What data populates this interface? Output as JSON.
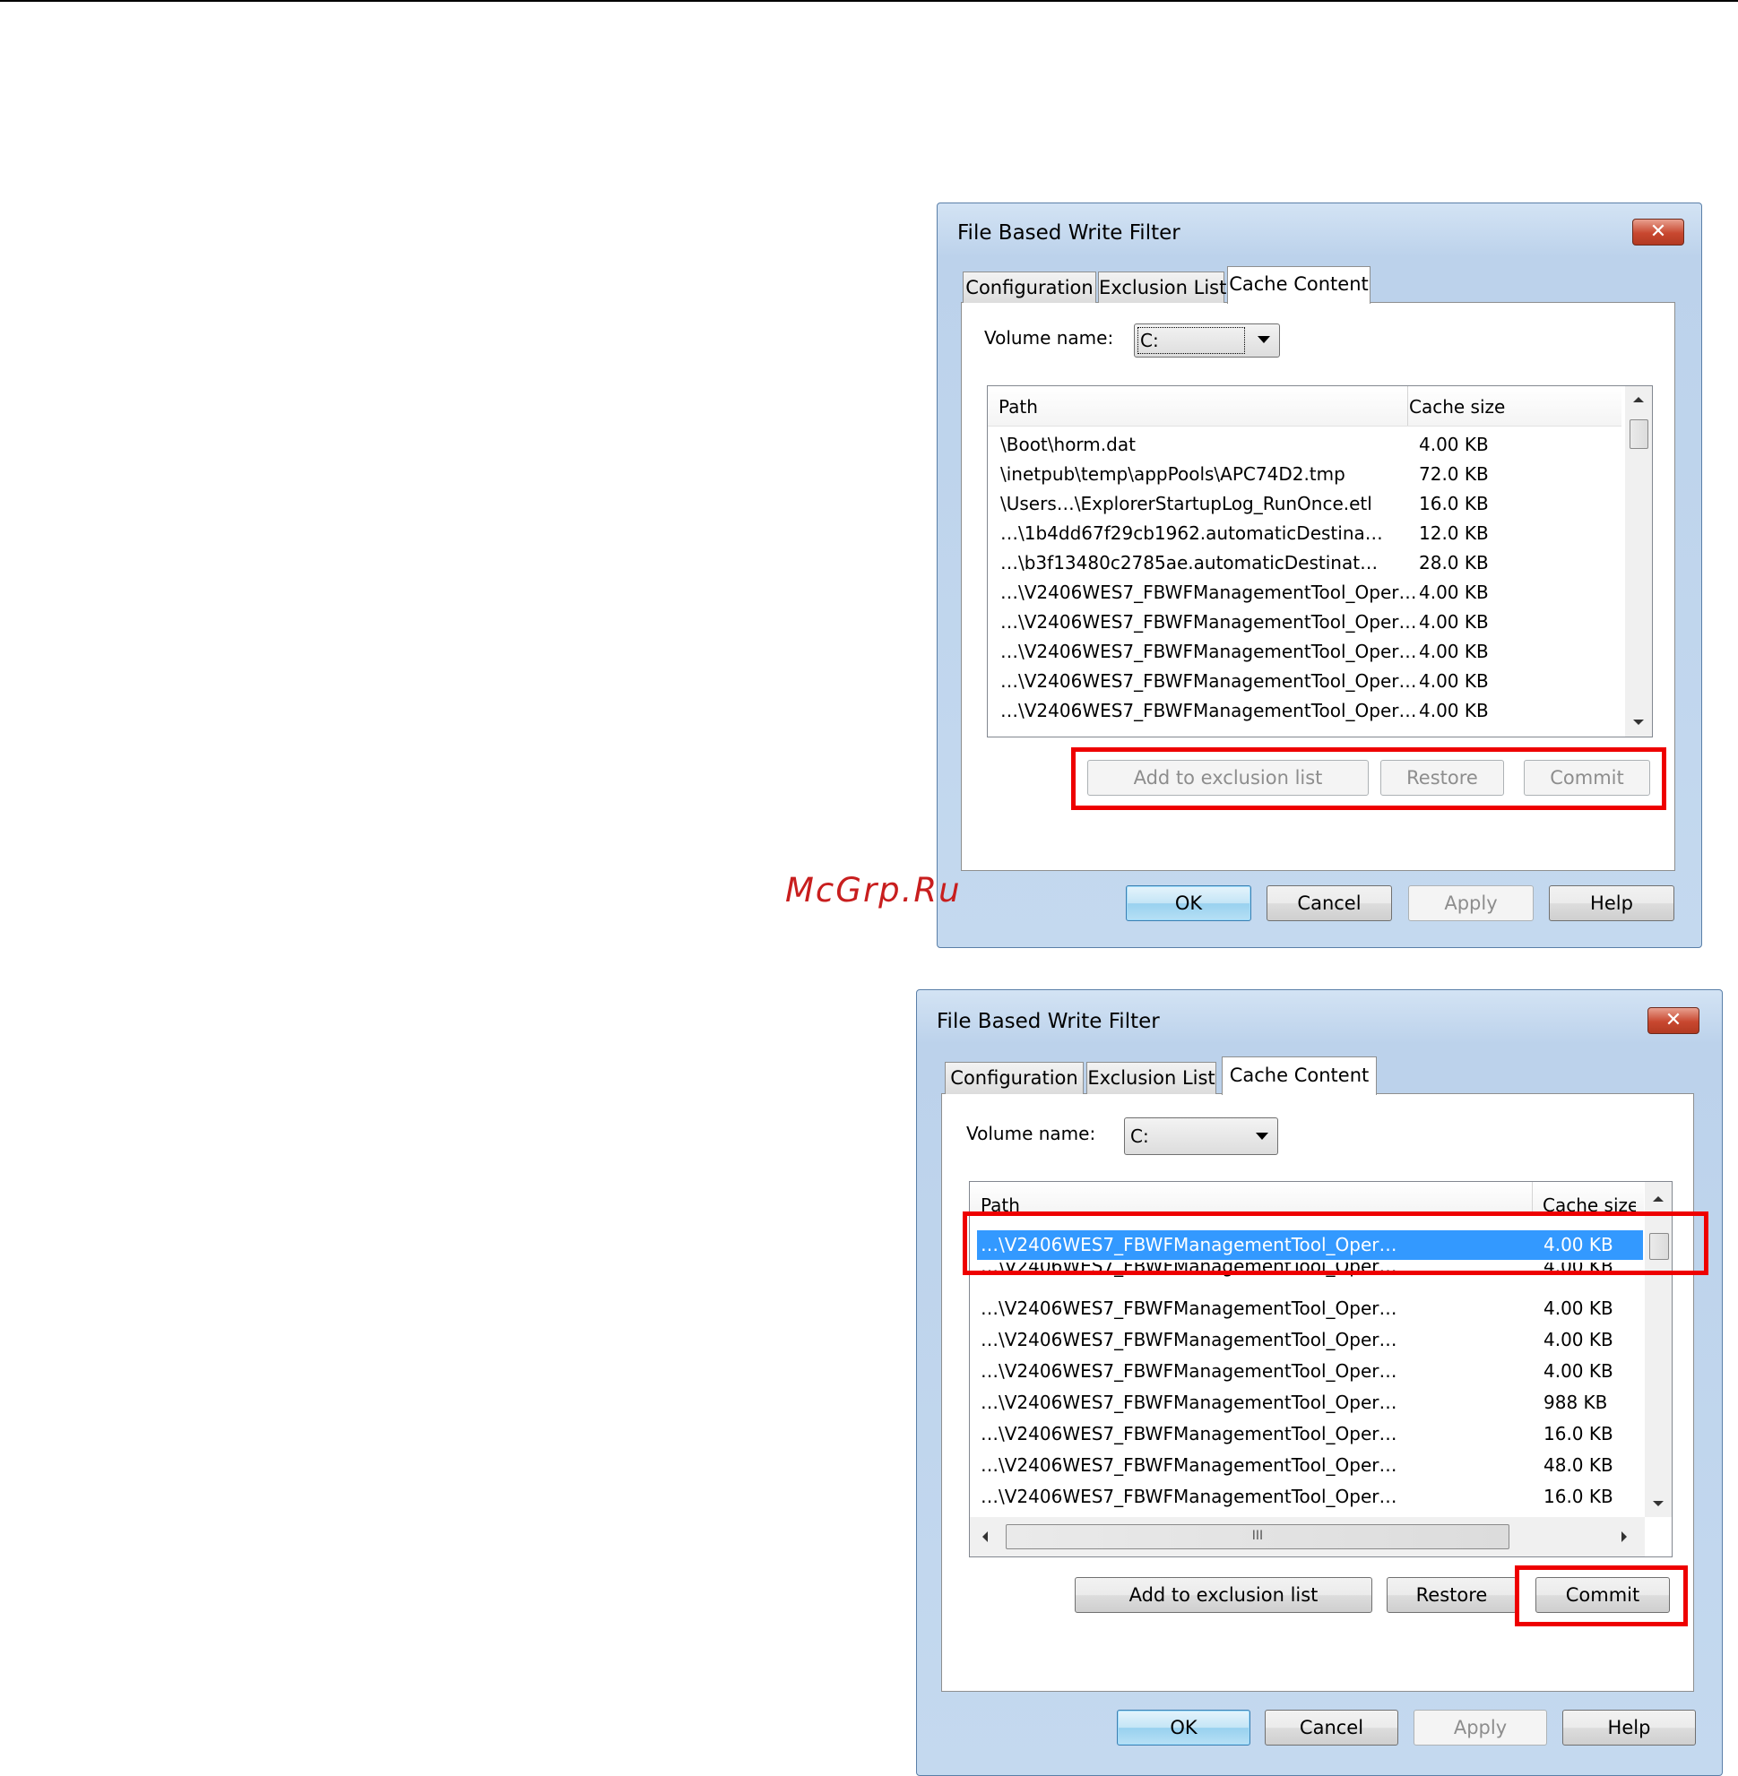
{
  "watermark": "McGrp.Ru",
  "dialogs": [
    {
      "title": "File Based Write Filter",
      "close_symbol": "✕",
      "tabs": [
        "Configuration",
        "Exclusion List",
        "Cache Content"
      ],
      "active_tab": "Cache Content",
      "volume_label": "Volume name:",
      "volume_value": "C:",
      "columns": [
        "Path",
        "Cache size"
      ],
      "rows": [
        {
          "path": "\\Boot\\horm.dat",
          "size": "4.00 KB"
        },
        {
          "path": "\\inetpub\\temp\\appPools\\APC74D2.tmp",
          "size": "72.0 KB"
        },
        {
          "path": "\\Users…\\ExplorerStartupLog_RunOnce.etl",
          "size": "16.0 KB"
        },
        {
          "path": "…\\1b4dd67f29cb1962.automaticDestina…",
          "size": "12.0 KB"
        },
        {
          "path": "…\\b3f13480c2785ae.automaticDestinat…",
          "size": "28.0 KB"
        },
        {
          "path": "…\\V2406WES7_FBWFManagementTool_Oper…",
          "size": "4.00 KB"
        },
        {
          "path": "…\\V2406WES7_FBWFManagementTool_Oper…",
          "size": "4.00 KB"
        },
        {
          "path": "…\\V2406WES7_FBWFManagementTool_Oper…",
          "size": "4.00 KB"
        },
        {
          "path": "…\\V2406WES7_FBWFManagementTool_Oper…",
          "size": "4.00 KB"
        },
        {
          "path": "…\\V2406WES7_FBWFManagementTool_Oper…",
          "size": "4.00 KB"
        }
      ],
      "action_buttons": {
        "add": "Add to exclusion list",
        "restore": "Restore",
        "commit": "Commit",
        "enabled": false
      },
      "footer_buttons": {
        "ok": "OK",
        "cancel": "Cancel",
        "apply": "Apply",
        "help": "Help"
      }
    },
    {
      "title": "File Based Write Filter",
      "close_symbol": "✕",
      "tabs": [
        "Configuration",
        "Exclusion List",
        "Cache Content"
      ],
      "active_tab": "Cache Content",
      "volume_label": "Volume name:",
      "volume_value": "C:",
      "columns": [
        "Path",
        "Cache size"
      ],
      "rows": [
        {
          "path": "…\\V2406WES7_FBWFManagementTool_Oper…",
          "size": "4.00 KB",
          "selected": true
        },
        {
          "path": "…\\V2406WES7_FBWFManagementTool_Oper…",
          "size": "4.00 KB"
        },
        {
          "path": "…\\V2406WES7_FBWFManagementTool_Oper…",
          "size": "4.00 KB"
        },
        {
          "path": "…\\V2406WES7_FBWFManagementTool_Oper…",
          "size": "4.00 KB"
        },
        {
          "path": "…\\V2406WES7_FBWFManagementTool_Oper…",
          "size": "4.00 KB"
        },
        {
          "path": "…\\V2406WES7_FBWFManagementTool_Oper…",
          "size": "988 KB"
        },
        {
          "path": "…\\V2406WES7_FBWFManagementTool_Oper…",
          "size": "16.0 KB"
        },
        {
          "path": "…\\V2406WES7_FBWFManagementTool_Oper…",
          "size": "48.0 KB"
        },
        {
          "path": "…\\V2406WES7_FBWFManagementTool_Oper…",
          "size": "16.0 KB"
        }
      ],
      "hscroll_grip": "III",
      "action_buttons": {
        "add": "Add to exclusion list",
        "restore": "Restore",
        "commit": "Commit",
        "enabled": true
      },
      "footer_buttons": {
        "ok": "OK",
        "cancel": "Cancel",
        "apply": "Apply",
        "help": "Help"
      }
    }
  ],
  "colors": {
    "highlight": "#ee0000",
    "selection": "#3399ff",
    "watermark": "#c81e1e"
  }
}
